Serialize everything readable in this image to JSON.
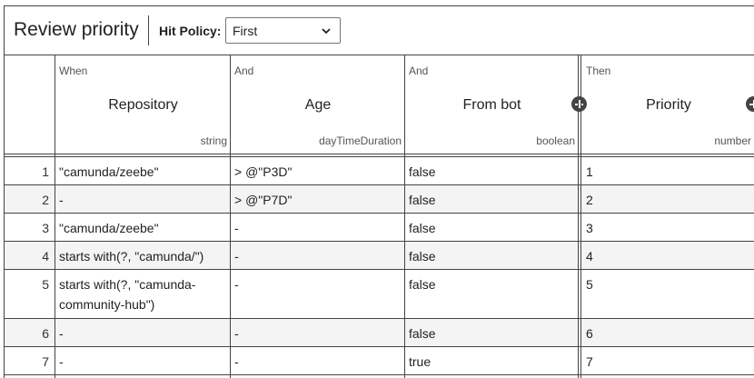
{
  "table": {
    "name": "Review priority",
    "hit_policy_label": "Hit Policy:",
    "hit_policy_value": "First"
  },
  "columns": [
    {
      "kind": "When",
      "label": "Repository",
      "type": "string"
    },
    {
      "kind": "And",
      "label": "Age",
      "type": "dayTimeDuration"
    },
    {
      "kind": "And",
      "label": "From bot",
      "type": "boolean"
    },
    {
      "kind": "Then",
      "label": "Priority",
      "type": "number"
    }
  ],
  "rows": [
    {
      "index": "1",
      "cells": [
        "\"camunda/zeebe\"",
        "> @\"P3D\"",
        "false",
        "1"
      ]
    },
    {
      "index": "2",
      "cells": [
        "-",
        "> @\"P7D\"",
        "false",
        "2"
      ]
    },
    {
      "index": "3",
      "cells": [
        "\"camunda/zeebe\"",
        "-",
        "false",
        "3"
      ]
    },
    {
      "index": "4",
      "cells": [
        "starts with(?, \"camunda/\")",
        "-",
        "false",
        "4"
      ]
    },
    {
      "index": "5",
      "cells": [
        "starts with(?, \"camunda-community-hub\")",
        "-",
        "false",
        "5"
      ]
    },
    {
      "index": "6",
      "cells": [
        "-",
        "-",
        "false",
        "6"
      ]
    },
    {
      "index": "7",
      "cells": [
        "-",
        "-",
        "true",
        "7"
      ]
    }
  ],
  "icons": {
    "add_input": "plus-circle-icon",
    "add_output": "plus-circle-icon",
    "dropdown": "chevron-down-icon"
  }
}
